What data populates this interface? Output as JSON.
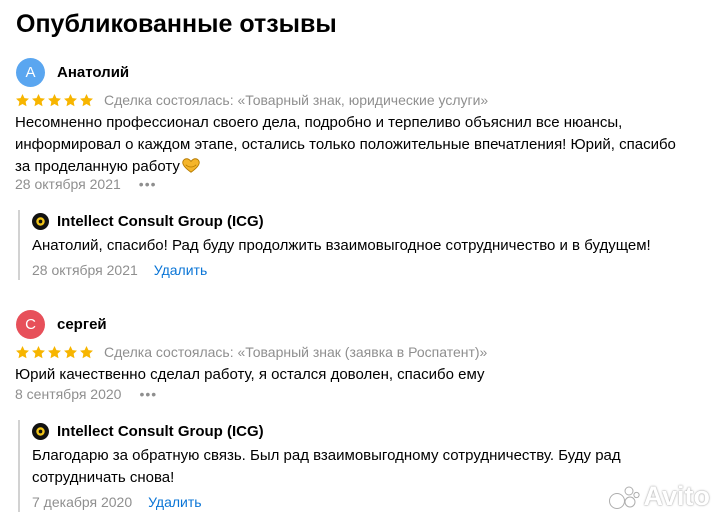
{
  "title": "Опубликованные отзывы",
  "colors": {
    "star": "#f7b500",
    "muted_text": "#8f8f8f",
    "link": "#0a75d6",
    "avatar_1": "#5aa6f0",
    "avatar_2": "#e7505a"
  },
  "reviews": [
    {
      "avatar_letter": "А",
      "author": "Анатолий",
      "rating": 5,
      "deal": "Сделка состоялась: «Товарный знак, юридические услуги»",
      "text": "Несомненно профессионал своего дела, подробно и терпеливо объяснил все нюансы, информировал о каждом этапе, остались только положительные впечатления! Юрий, спасибо за проделанную работу",
      "emoji_icon": "heart-hands-icon",
      "date": "28 октября 2021",
      "more_label": "•••",
      "reply": {
        "company": "Intellect Consult Group (ICG)",
        "text": "Анатолий, спасибо! Рад буду продолжить взаимовыгодное сотрудничество и в будущем!",
        "date": "28 октября 2021",
        "delete_label": "Удалить"
      }
    },
    {
      "avatar_letter": "С",
      "author": "сергей",
      "rating": 5,
      "deal": "Сделка состоялась: «Товарный знак (заявка в Роспатент)»",
      "text": "Юрий качественно сделал работу, я остался доволен, спасибо ему",
      "date": "8 сентября 2020",
      "more_label": "•••",
      "reply": {
        "company": "Intellect Consult Group (ICG)",
        "text": "Благодарю за обратную связь. Был рад взаимовыгодному сотрудничеству. Буду рад сотрудничать снова!",
        "date": "7 декабря 2020",
        "delete_label": "Удалить"
      }
    }
  ],
  "watermark": "Avito"
}
